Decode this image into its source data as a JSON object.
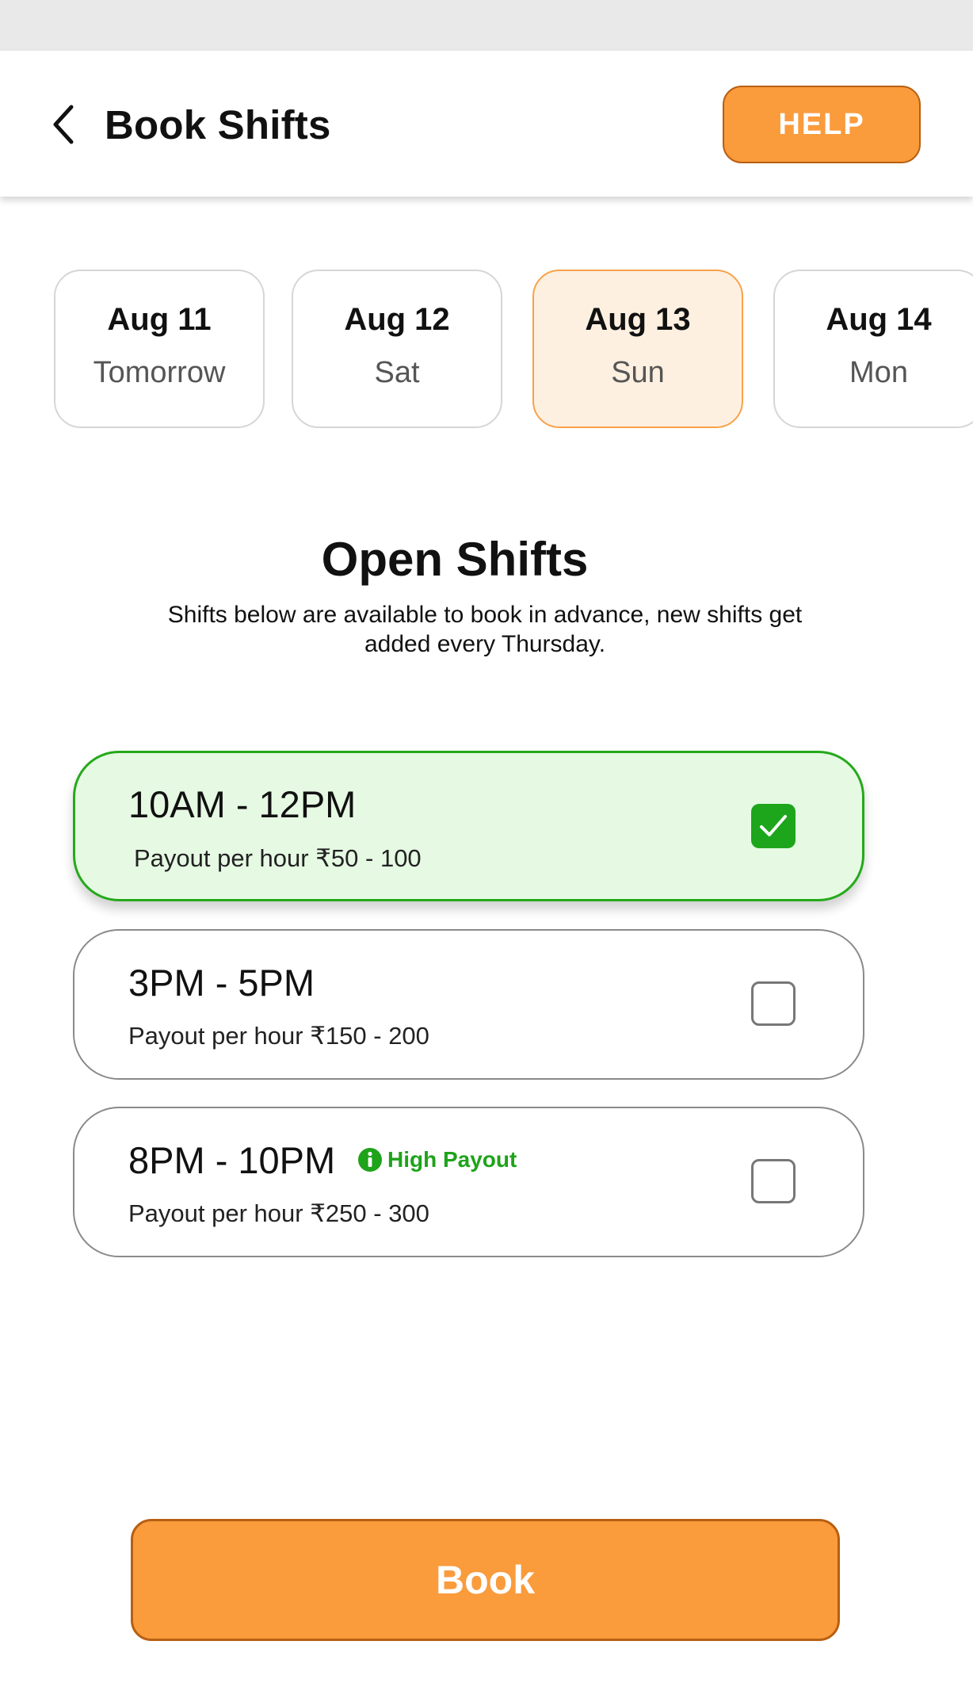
{
  "header": {
    "title": "Book Shifts",
    "help_label": "HELP",
    "back_icon": "chevron-left-icon"
  },
  "dates": [
    {
      "day": "Aug 11",
      "sub": "Tomorrow",
      "selected": false
    },
    {
      "day": "Aug 12",
      "sub": "Sat",
      "selected": false
    },
    {
      "day": "Aug 13",
      "sub": "Sun",
      "selected": true
    },
    {
      "day": "Aug 14",
      "sub": "Mon",
      "selected": false
    }
  ],
  "open_shifts": {
    "title": "Open Shifts",
    "description": "Shifts below are available to book in advance, new shifts get added every Thursday."
  },
  "shifts": [
    {
      "time": "10AM - 12PM",
      "payout": "Payout per hour ₹50 - 100",
      "selected": true
    },
    {
      "time": "3PM - 5PM",
      "payout": "Payout per hour ₹150 - 200",
      "selected": false
    },
    {
      "time": "8PM - 10PM",
      "payout": "Payout per hour ₹250 - 300",
      "selected": false,
      "badge": "High Payout",
      "badge_icon": "info-icon"
    }
  ],
  "book_label": "Book",
  "colors": {
    "accent": "#fa9b3c",
    "accent_border": "#b75f12",
    "selected_date_bg": "#fef0e1",
    "selected_shift_bg": "#e6fae3",
    "success": "#1da61b"
  }
}
